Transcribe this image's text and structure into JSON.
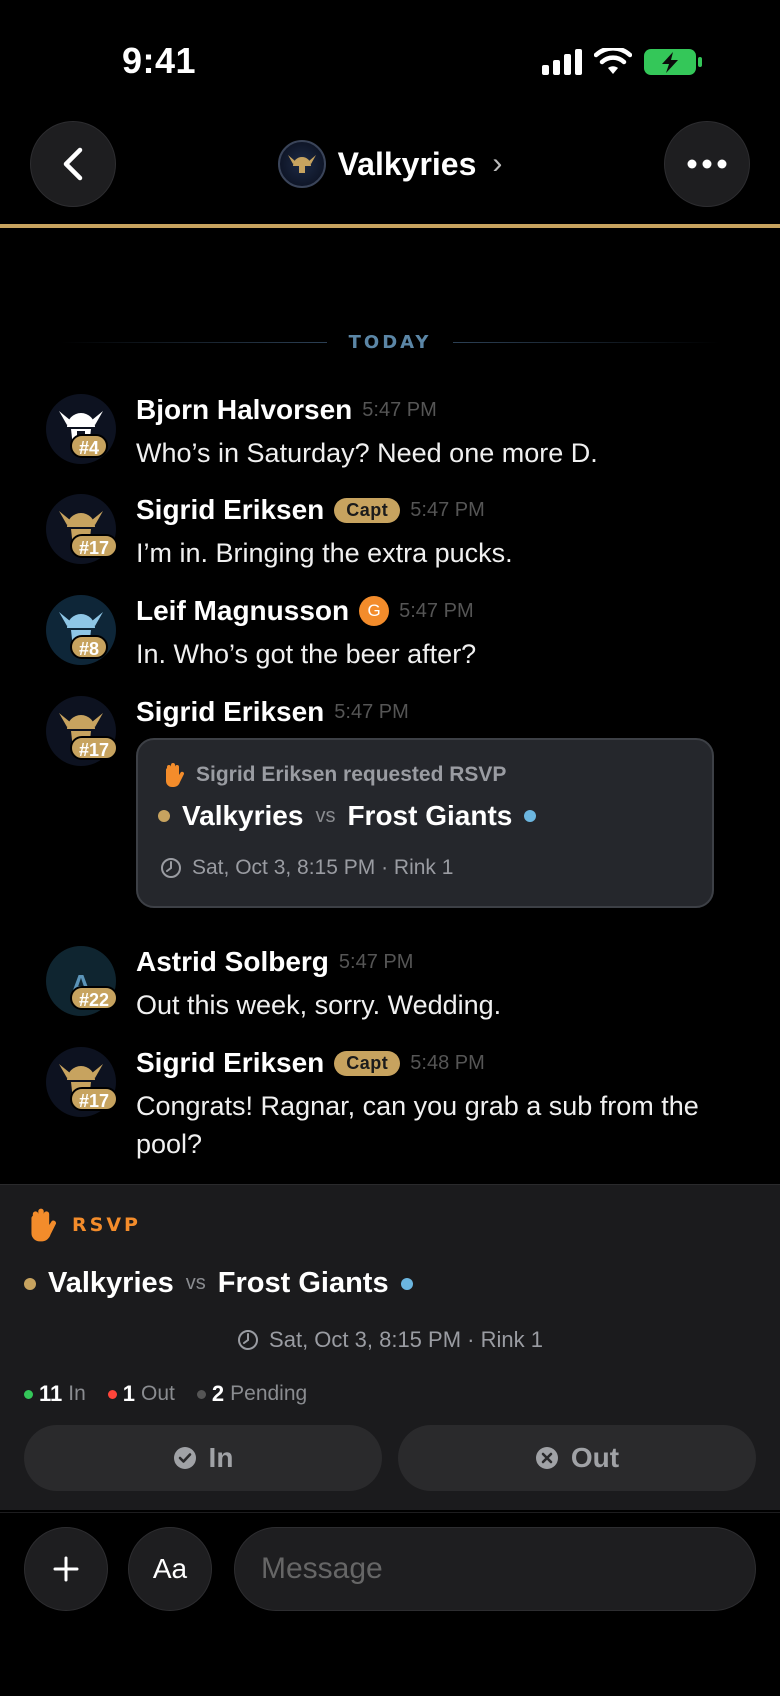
{
  "status": {
    "time": "9:41"
  },
  "header": {
    "title": "Valkyries"
  },
  "divider": {
    "label": "TODAY"
  },
  "messages": [
    {
      "sender": "Bjorn Halvorsen",
      "number": "#4",
      "time": "5:47 PM",
      "text": "Who’s in Saturday? Need one more D."
    },
    {
      "sender": "Sigrid Eriksen",
      "number": "#17",
      "badge": "Capt",
      "time": "5:47 PM",
      "text": "I’m in. Bringing the extra pucks."
    },
    {
      "sender": "Leif Magnusson",
      "number": "#8",
      "badge": "G",
      "time": "5:47 PM",
      "text": "In. Who’s got the beer after?"
    },
    {
      "sender": "Sigrid Eriksen",
      "number": "#17",
      "time": "5:47 PM",
      "card": {
        "request": "Sigrid Eriksen requested RSVP",
        "home": "Valkyries",
        "vs": "vs",
        "away": "Frost Giants",
        "when": "Sat, Oct 3, 8:15 PM · Rink 1"
      }
    },
    {
      "sender": "Astrid Solberg",
      "initial": "A",
      "number": "#22",
      "time": "5:47 PM",
      "text": "Out this week, sorry. Wedding."
    },
    {
      "sender": "Sigrid Eriksen",
      "number": "#17",
      "badge": "Capt",
      "time": "5:48 PM",
      "text": "Congrats! Ragnar, can you grab a sub from the pool?"
    }
  ],
  "rsvp_panel": {
    "label": "RSVP",
    "home": "Valkyries",
    "vs": "vs",
    "away": "Frost Giants",
    "when": "Sat, Oct 3, 8:15 PM · Rink 1",
    "counts": {
      "in": "11",
      "in_label": "In",
      "out": "1",
      "out_label": "Out",
      "pending": "2",
      "pending_label": "Pending"
    },
    "in_button": "In",
    "out_button": "Out"
  },
  "composer": {
    "placeholder": "Message",
    "aa_label": "Aa"
  },
  "colors": {
    "gold": "#c7a35f",
    "orange": "#f38c2b",
    "blue": "#6cb6e0",
    "green": "#34c759",
    "red": "#ff453a"
  }
}
